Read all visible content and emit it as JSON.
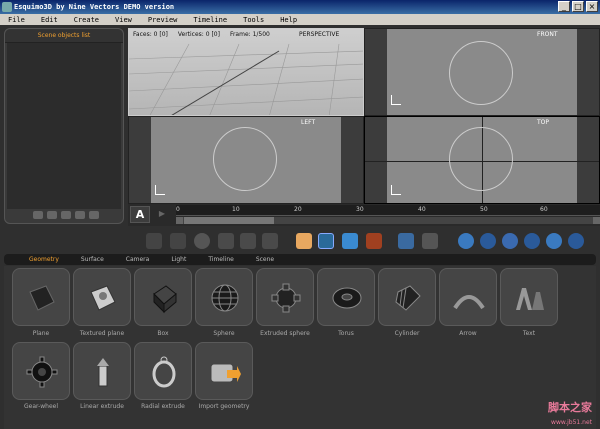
{
  "window": {
    "title": "Esquimo3D by Nine Vectors DEMO version"
  },
  "menu": [
    "File",
    "Edit",
    "Create",
    "View",
    "Preview",
    "Timeline",
    "Tools",
    "Help"
  ],
  "scene_panel": {
    "title": "Scene objects list"
  },
  "viewports": {
    "perspective": {
      "label": "PERSPECTIVE",
      "faces": "Faces: 0 [0]",
      "vertices": "Vertices: 0 [0]",
      "frame": "Frame: 1/500"
    },
    "front": {
      "label": "FRONT"
    },
    "left": {
      "label": "LEFT"
    },
    "top": {
      "label": "TOP"
    }
  },
  "timeline": {
    "a_label": "A",
    "ticks": [
      "0",
      "10",
      "20",
      "30",
      "40",
      "50",
      "60"
    ]
  },
  "tabs": [
    "Geometry",
    "Surface",
    "Camera",
    "Light",
    "Timeline",
    "Scene"
  ],
  "active_tab": "Geometry",
  "geometry_items": [
    "Plane",
    "Textured plane",
    "Box",
    "Sphere",
    "Extruded sphere",
    "Torus",
    "Cylinder",
    "Arrow",
    "Text",
    "Gear-wheel",
    "Linear extrude",
    "Radial extrude",
    "Import geometry"
  ],
  "icons": {
    "camera": "hand-icon",
    "accent": "#f0a030"
  },
  "watermark": {
    "main": "脚本之家",
    "url": "www.jb51.net"
  }
}
